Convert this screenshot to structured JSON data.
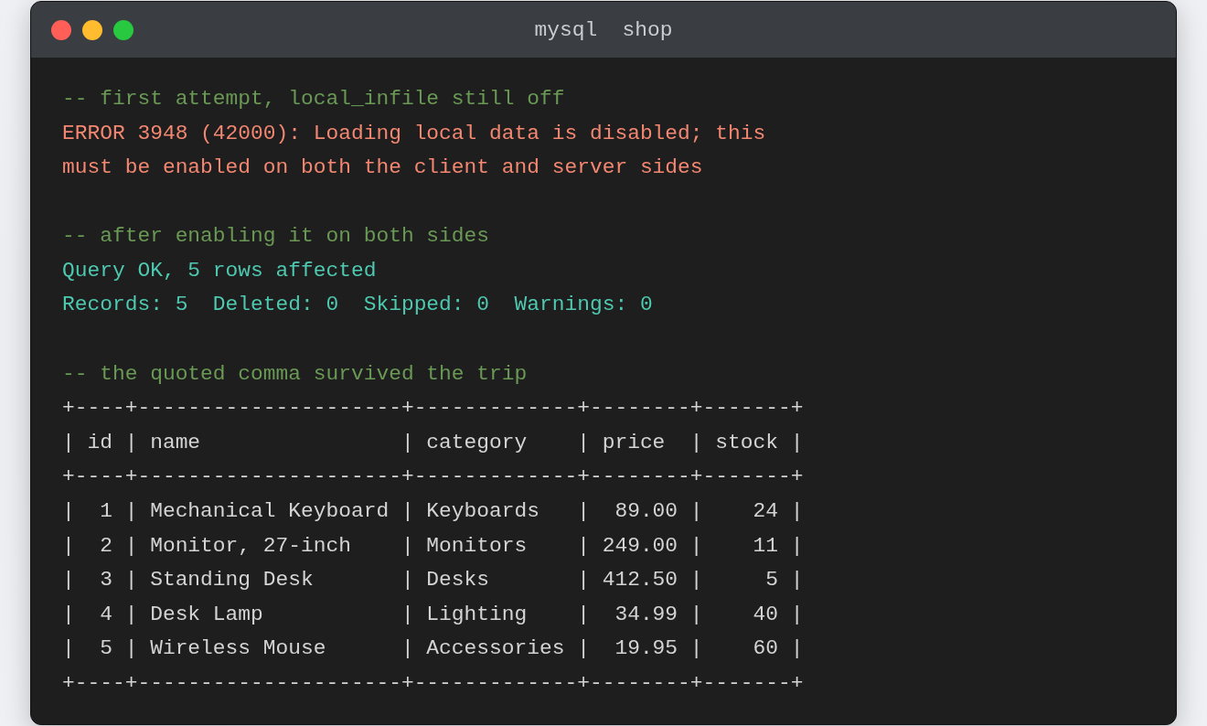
{
  "window": {
    "title": "mysql  shop",
    "controls": [
      {
        "color": "#ff5f57"
      },
      {
        "color": "#febc2e"
      },
      {
        "color": "#28c840"
      }
    ]
  },
  "terminal": {
    "blocks": [
      {
        "lines": [
          {
            "kind": "comment",
            "text": "-- first attempt, local_infile still off"
          },
          {
            "kind": "error",
            "text": "ERROR 3948 (42000): Loading local data is disabled; this"
          },
          {
            "kind": "error",
            "text": "must be enabled on both the client and server sides"
          }
        ]
      },
      {
        "lines": [
          {
            "kind": "comment",
            "text": "-- after enabling it on both sides"
          },
          {
            "kind": "ok",
            "text": "Query OK, 5 rows affected"
          },
          {
            "kind": "ok",
            "text": "Records: 5  Deleted: 0  Skipped: 0  Warnings: 0"
          }
        ]
      },
      {
        "lines": [
          {
            "kind": "comment",
            "text": "-- the quoted comma survived the trip"
          },
          {
            "kind": "border",
            "text": "+----+---------------------+-------------+--------+-------+"
          },
          {
            "kind": "header",
            "text": "| id | name                | category    | price  | stock |"
          },
          {
            "kind": "border",
            "text": "+----+---------------------+-------------+--------+-------+"
          },
          {
            "kind": "row",
            "text": "|  1 | Mechanical Keyboard | Keyboards   |  89.00 |    24 |"
          },
          {
            "kind": "row",
            "text": "|  2 | Monitor, 27-inch    | Monitors    | 249.00 |    11 |"
          },
          {
            "kind": "row",
            "text": "|  3 | Standing Desk       | Desks       | 412.50 |     5 |"
          },
          {
            "kind": "row",
            "text": "|  4 | Desk Lamp           | Lighting    |  34.99 |    40 |"
          },
          {
            "kind": "row",
            "text": "|  5 | Wireless Mouse      | Accessories |  19.95 |    60 |"
          },
          {
            "kind": "border",
            "text": "+----+---------------------+-------------+--------+-------+"
          }
        ]
      }
    ]
  }
}
